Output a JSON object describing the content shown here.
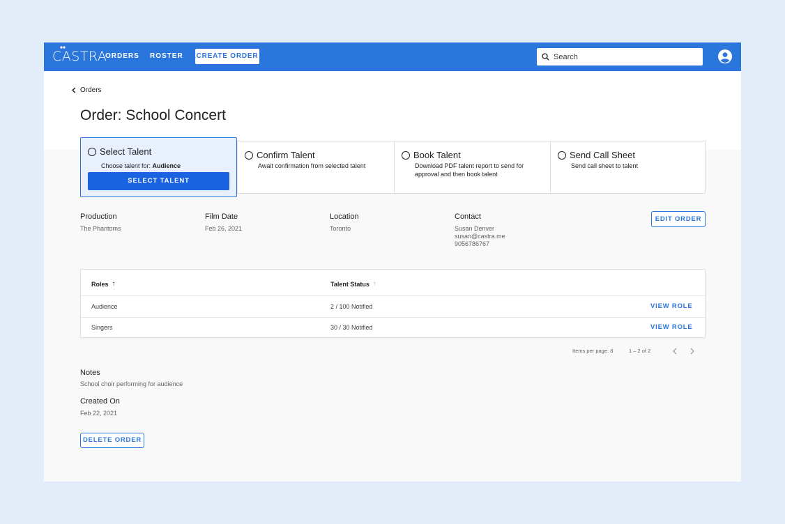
{
  "nav": {
    "logo": "CASTRA",
    "links": [
      "ORDERS",
      "ROSTER"
    ],
    "create_label": "CREATE ORDER",
    "search_placeholder": "Search"
  },
  "breadcrumb": "Orders",
  "title": "Order: School Concert",
  "steps": [
    {
      "title": "Select Talent",
      "desc_prefix": "Choose talent for: ",
      "desc_bold": "Audience",
      "button": "SELECT TALENT"
    },
    {
      "title": "Confirm Talent",
      "desc": "Await confirmation from selected talent"
    },
    {
      "title": "Book Talent",
      "desc": "Download PDF talent report to send for approval and then book talent"
    },
    {
      "title": "Send Call Sheet",
      "desc": "Send call sheet to talent"
    }
  ],
  "info": {
    "production_label": "Production",
    "production": "The Phantoms",
    "film_date_label": "Film Date",
    "film_date": "Feb 26, 2021",
    "location_label": "Location",
    "location": "Toronto",
    "contact_label": "Contact",
    "contact_name": "Susan Denver",
    "contact_email": "susan@castra.me",
    "contact_phone": "9056786767",
    "edit_label": "EDIT ORDER"
  },
  "table": {
    "col_roles": "Roles",
    "col_status": "Talent Status",
    "rows": [
      {
        "role": "Audience",
        "status": "2 / 100 Notified",
        "action": "VIEW ROLE"
      },
      {
        "role": "Singers",
        "status": "30 / 30 Notified",
        "action": "VIEW ROLE"
      }
    ],
    "items_per_page": "Items per page: 8",
    "range": "1 – 2 of 2"
  },
  "notes": {
    "label": "Notes",
    "value": "School choir performing for audience"
  },
  "created": {
    "label": "Created On",
    "value": "Feb 22, 2021"
  },
  "delete_label": "DELETE ORDER",
  "colors": {
    "brand": "#2b76dc",
    "background": "#e3edfa"
  }
}
